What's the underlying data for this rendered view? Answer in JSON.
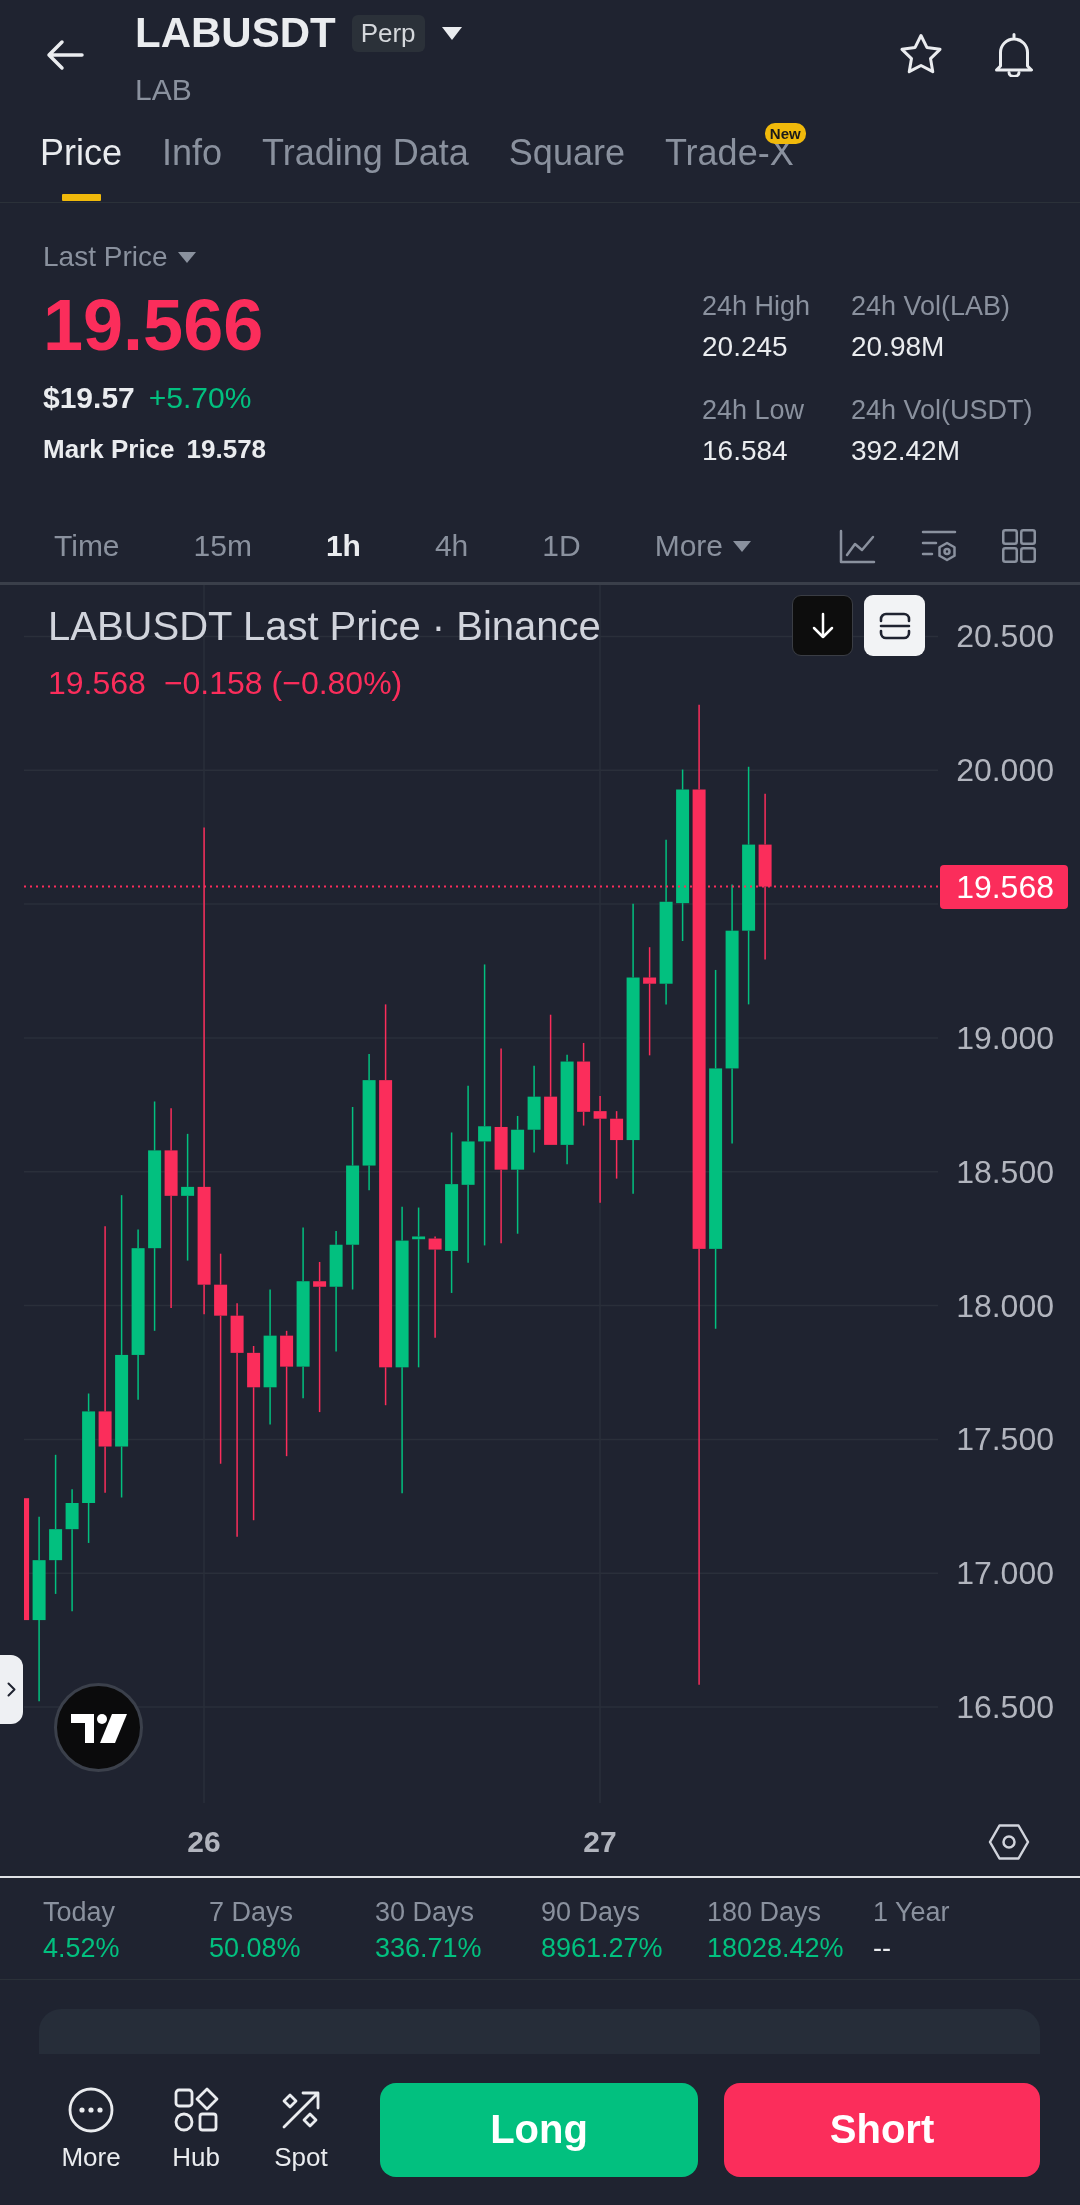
{
  "header": {
    "title": "LABUSDT",
    "badge": "Perp",
    "subtitle": "LAB"
  },
  "tabs": [
    {
      "label": "Price",
      "selected": true
    },
    {
      "label": "Info",
      "selected": false
    },
    {
      "label": "Trading Data",
      "selected": false
    },
    {
      "label": "Square",
      "selected": false
    },
    {
      "label": "Trade-X",
      "selected": false,
      "badge": "New"
    }
  ],
  "price_panel": {
    "selector": "Last Price",
    "last_price": "19.566",
    "last_price_falling": true,
    "usd_price": "$19.57",
    "change": "+5.70%",
    "change_falling": false,
    "mark_price_label": "Mark Price",
    "mark_price": "19.578",
    "stats": [
      {
        "label": "24h High",
        "value": "20.245"
      },
      {
        "label": "24h Vol(LAB)",
        "value": "20.98M"
      },
      {
        "label": "24h Low",
        "value": "16.584"
      },
      {
        "label": "24h Vol(USDT)",
        "value": "392.42M"
      }
    ]
  },
  "intervals": [
    {
      "label": "Time",
      "selected": false,
      "kind": "option"
    },
    {
      "label": "15m",
      "selected": false,
      "kind": "option"
    },
    {
      "label": "1h",
      "selected": true,
      "kind": "option"
    },
    {
      "label": "4h",
      "selected": false,
      "kind": "option"
    },
    {
      "label": "1D",
      "selected": false,
      "kind": "option"
    },
    {
      "label": "More",
      "selected": false,
      "kind": "menu"
    }
  ],
  "chart": {
    "title": "LABUSDT Last Price · Binance",
    "last": "19.568",
    "change": "−0.158 (−0.80%)",
    "falling": true,
    "price_tag": "19.568",
    "y_labels": [
      "20.500",
      "20.000",
      "19.000",
      "18.500",
      "18.000",
      "17.500",
      "17.000",
      "16.500"
    ],
    "x_labels": [
      "26",
      "27"
    ]
  },
  "returns": [
    {
      "label": "Today",
      "value": "4.52%",
      "color": "#02c07f"
    },
    {
      "label": "7 Days",
      "value": "50.08%",
      "color": "#02c07f"
    },
    {
      "label": "30 Days",
      "value": "336.71%",
      "color": "#02c07f"
    },
    {
      "label": "90 Days",
      "value": "8961.27%",
      "color": "#02c07f"
    },
    {
      "label": "180 Days",
      "value": "18028.42%",
      "color": "#02c07f"
    },
    {
      "label": "1 Year",
      "value": "--",
      "color": "#eaecef"
    }
  ],
  "bottom_nav": [
    {
      "label": "More"
    },
    {
      "label": "Hub"
    },
    {
      "label": "Spot"
    }
  ],
  "actions": [
    {
      "label": "Long",
      "kind": "long"
    },
    {
      "label": "Short",
      "kind": "short"
    }
  ]
}
